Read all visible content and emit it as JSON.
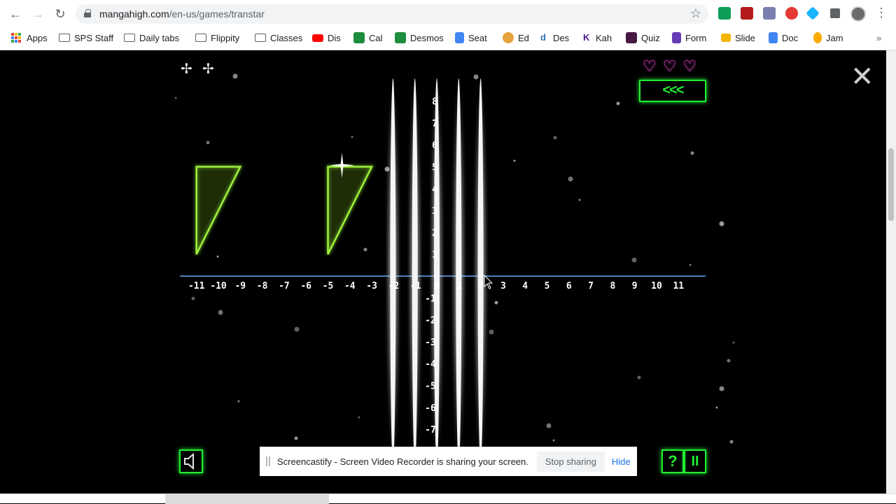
{
  "browser": {
    "url_host": "mangahigh.com",
    "url_path": "/en-us/games/transtar",
    "bookmarks": [
      {
        "label": "Apps",
        "icon": "apps-grid-icon"
      },
      {
        "label": "SPS Staff",
        "icon": "folder-icon"
      },
      {
        "label": "Daily tabs",
        "icon": "folder-icon"
      },
      {
        "label": "Flippity",
        "icon": "folder-icon"
      },
      {
        "label": "Classes",
        "icon": "folder-icon"
      },
      {
        "label": "Dis",
        "icon": "youtube-icon"
      },
      {
        "label": "Cal",
        "icon": "calendar-icon"
      },
      {
        "label": "Desmos",
        "icon": "desmos-icon"
      },
      {
        "label": "Seat",
        "icon": "docs-icon"
      },
      {
        "label": "Ed",
        "icon": "edpuzzle-icon"
      },
      {
        "label": "Des",
        "icon": "desmos-d-icon"
      },
      {
        "label": "Kah",
        "icon": "kahoot-icon"
      },
      {
        "label": "Quiz",
        "icon": "quizizz-icon"
      },
      {
        "label": "Form",
        "icon": "forms-icon"
      },
      {
        "label": "Slide",
        "icon": "slides-icon"
      },
      {
        "label": "Doc",
        "icon": "docs-icon"
      },
      {
        "label": "Jam",
        "icon": "jamboard-icon"
      }
    ],
    "overflow": "»"
  },
  "game": {
    "back_button": "<<<",
    "close": "✕",
    "hearts": [
      "♡",
      "♡",
      "♡"
    ],
    "help_button": "?",
    "pause_button": "II",
    "x_ticks": [
      "-11",
      "-10",
      "-9",
      "-8",
      "-7",
      "-6",
      "-5",
      "-4",
      "-3",
      "-2",
      "-1",
      "0",
      "1",
      "2",
      "3",
      "4",
      "5",
      "6",
      "7",
      "8",
      "9",
      "10",
      "11"
    ],
    "y_ticks_pos": [
      "8",
      "7",
      "6",
      "5",
      "4",
      "3",
      "2",
      "1"
    ],
    "y_ticks_neg": [
      "-1",
      "-2",
      "-3",
      "-4",
      "-5",
      "-6",
      "-7"
    ],
    "shapes": [
      {
        "name": "target-triangle",
        "points": [
          [
            -11,
            5
          ],
          [
            -9,
            5
          ],
          [
            -11,
            1
          ]
        ]
      },
      {
        "name": "player-triangle",
        "points": [
          [
            -5,
            5
          ],
          [
            -3,
            5
          ],
          [
            -5,
            1
          ]
        ]
      }
    ],
    "beams_x": [
      -2,
      -1,
      0,
      1,
      2
    ]
  },
  "share_banner": {
    "message": "Screencastify - Screen Video Recorder is sharing your screen.",
    "stop": "Stop sharing",
    "hide": "Hide"
  },
  "colors": {
    "accent_green": "#22ee33",
    "heart_pink": "#ff55ee",
    "triangle_stroke": "#9cf23a",
    "axis_blue": "#4a7fb5"
  }
}
